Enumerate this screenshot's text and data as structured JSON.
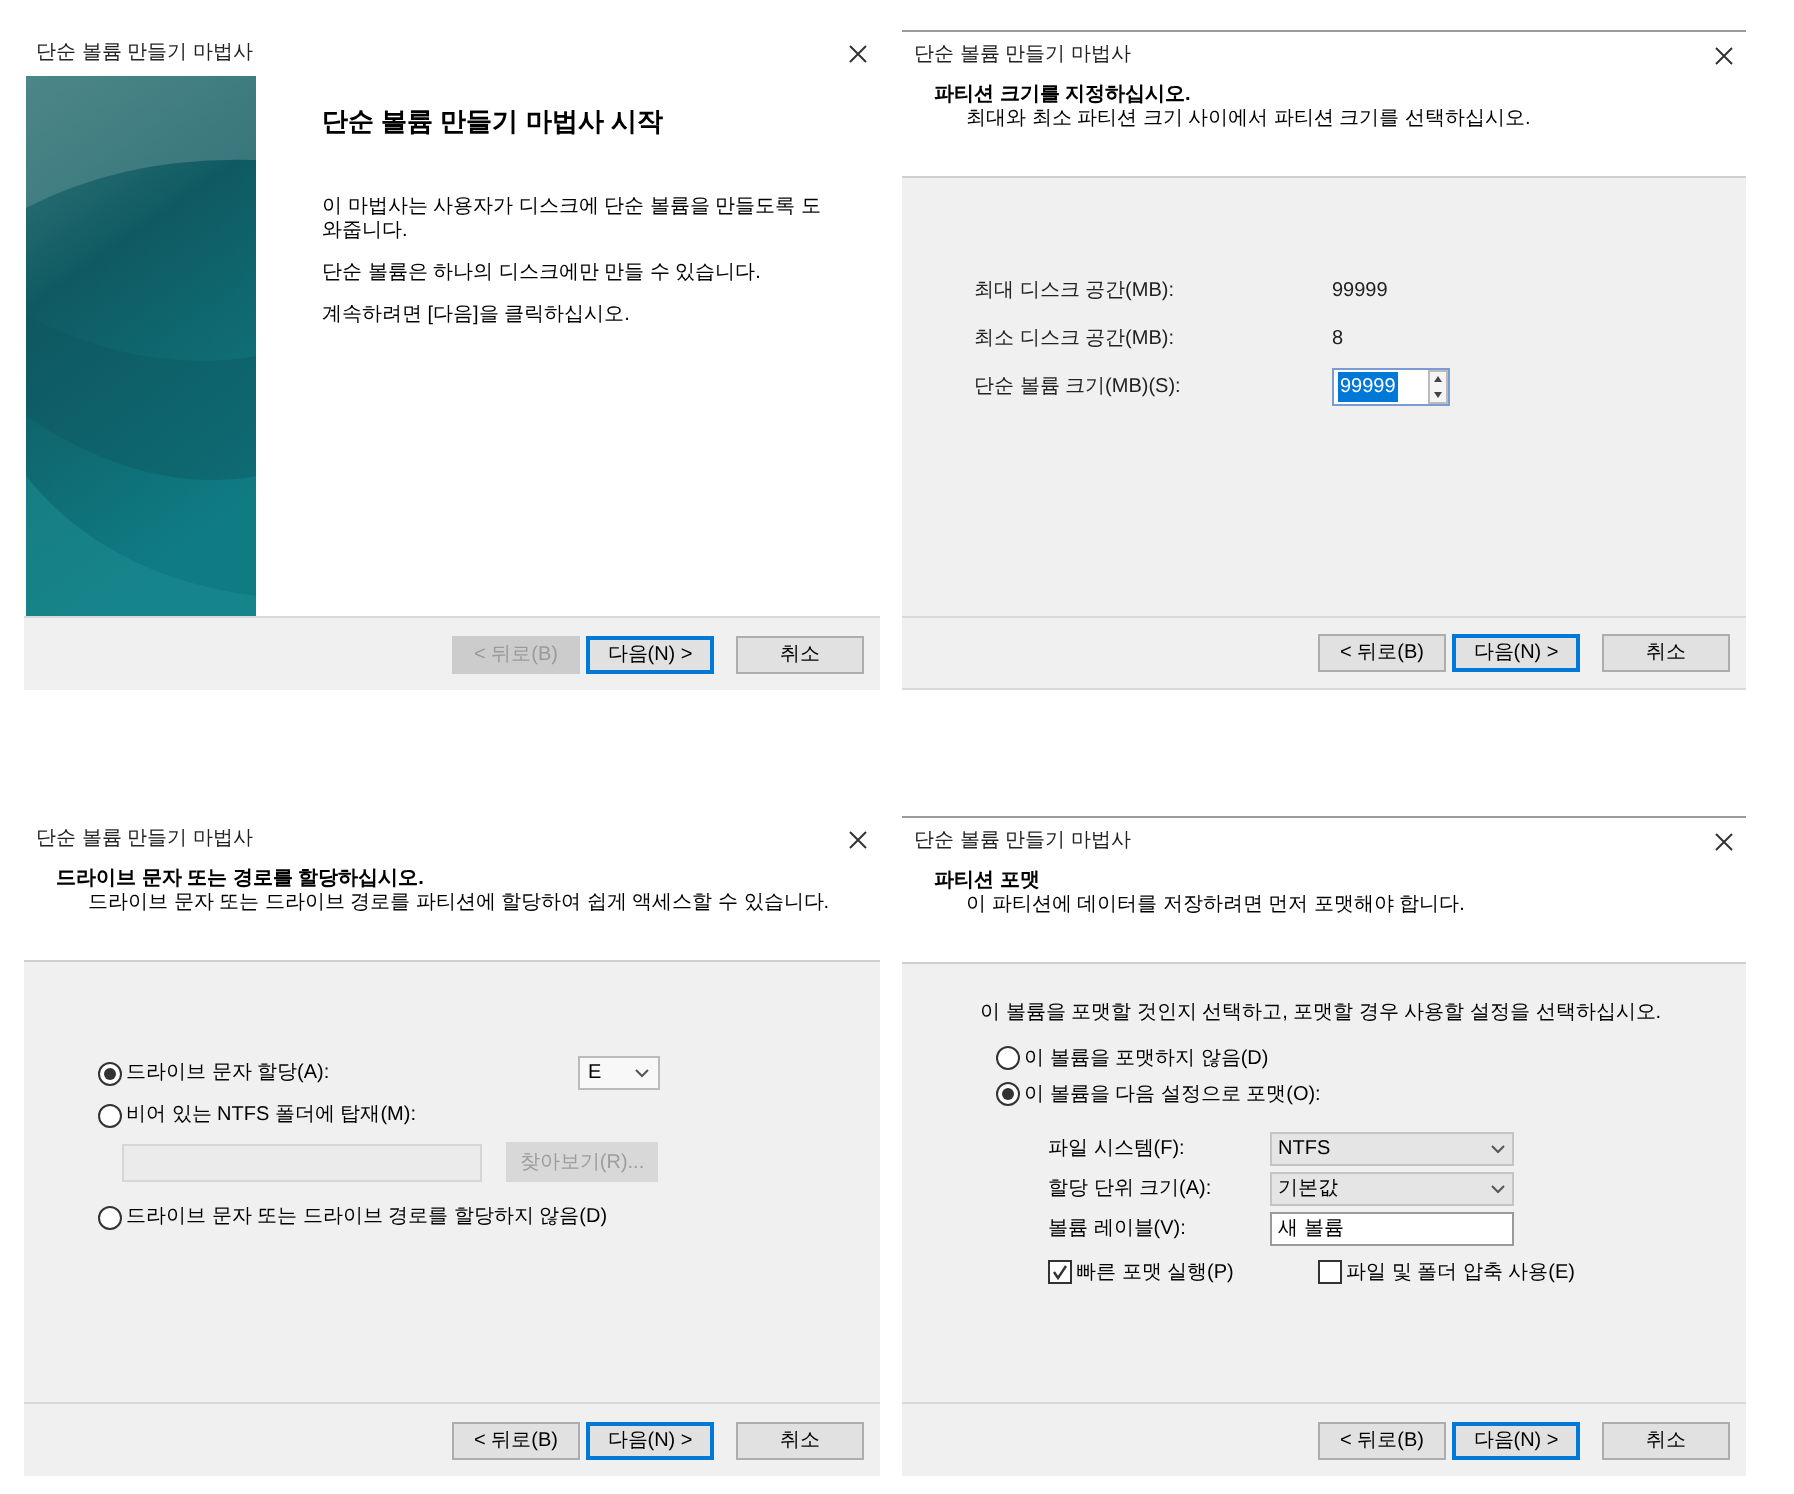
{
  "dialogs": [
    {
      "kind": "welcome",
      "title": "단순 볼륨 만들기 마법사",
      "heading": "단순 볼륨 만들기 마법사 시작",
      "paragraphs": [
        "이 마법사는 사용자가 디스크에 단순 볼륨을 만들도록 도와줍니다.",
        "단순 볼륨은 하나의 디스크에만 만들 수 있습니다.",
        "계속하려면 [다음]을 클릭하십시오."
      ],
      "buttons": [
        {
          "label": "< 뒤로(B)",
          "disabled": true,
          "default": false
        },
        {
          "label": "다음(N) >",
          "disabled": false,
          "default": true
        },
        {
          "label": "취소",
          "disabled": false,
          "default": false
        }
      ]
    },
    {
      "kind": "size",
      "title": "단순 볼륨 만들기 마법사",
      "header": {
        "title": "파티션 크기를 지정하십시오.",
        "subtitle": "최대와 최소 파티션 크기 사이에서 파티션 크기를 선택하십시오."
      },
      "rows": [
        {
          "kind": "readout",
          "label": "최대 디스크 공간(MB):",
          "value": "99999"
        },
        {
          "kind": "readout",
          "label": "최소 디스크 공간(MB):",
          "value": "8"
        },
        {
          "kind": "spinner",
          "label": "단순 볼륨 크기(MB)(S):",
          "value": "99999",
          "selected": true
        }
      ],
      "buttons": [
        {
          "label": "< 뒤로(B)",
          "disabled": false,
          "default": false
        },
        {
          "label": "다음(N) >",
          "disabled": false,
          "default": true
        },
        {
          "label": "취소",
          "disabled": false,
          "default": false
        }
      ]
    },
    {
      "kind": "drive",
      "title": "단순 볼륨 만들기 마법사",
      "header": {
        "title": "드라이브 문자 또는 경로를 할당하십시오.",
        "subtitle": "드라이브 문자 또는 드라이브 경로를 파티션에 할당하여 쉽게 액세스할 수 있습니다."
      },
      "options": [
        {
          "kind": "letter",
          "label": "드라이브 문자 할당(A):",
          "selected": true,
          "value": "E"
        },
        {
          "kind": "folder",
          "label": "비어 있는 NTFS 폴더에 탑재(M):",
          "selected": false,
          "browse": "찾아보기(R)...",
          "disabled": true
        },
        {
          "kind": "plain",
          "label": "드라이브 문자 또는 드라이브 경로를 할당하지 않음(D)",
          "selected": false
        }
      ],
      "buttons": [
        {
          "label": "< 뒤로(B)",
          "disabled": false,
          "default": false
        },
        {
          "label": "다음(N) >",
          "disabled": false,
          "default": true
        },
        {
          "label": "취소",
          "disabled": false,
          "default": false
        }
      ]
    },
    {
      "kind": "format",
      "title": "단순 볼륨 만들기 마법사",
      "header": {
        "title": "파티션 포맷",
        "subtitle": "이 파티션에 데이터를 저장하려면 먼저 포맷해야 합니다."
      },
      "intro": "이 볼륨을 포맷할 것인지 선택하고, 포맷할 경우 사용할 설정을 선택하십시오.",
      "options": [
        {
          "label": "이 볼륨을 포맷하지 않음(D)",
          "selected": false
        },
        {
          "label": "이 볼륨을 다음 설정으로 포맷(O):",
          "selected": true
        }
      ],
      "settings": [
        {
          "kind": "dropdown",
          "label": "파일 시스템(F):",
          "value": "NTFS"
        },
        {
          "kind": "dropdown",
          "label": "할당 단위 크기(A):",
          "value": "기본값"
        },
        {
          "kind": "text",
          "label": "볼륨 레이블(V):",
          "value": "새 볼륨"
        }
      ],
      "checkboxes": [
        {
          "label": "빠른 포맷 실행(P)",
          "checked": true
        },
        {
          "label": "파일 및 폴더 압축 사용(E)",
          "checked": false
        }
      ],
      "buttons": [
        {
          "label": "< 뒤로(B)",
          "disabled": false,
          "default": false
        },
        {
          "label": "다음(N) >",
          "disabled": false,
          "default": true
        },
        {
          "label": "취소",
          "disabled": false,
          "default": false
        }
      ]
    }
  ]
}
